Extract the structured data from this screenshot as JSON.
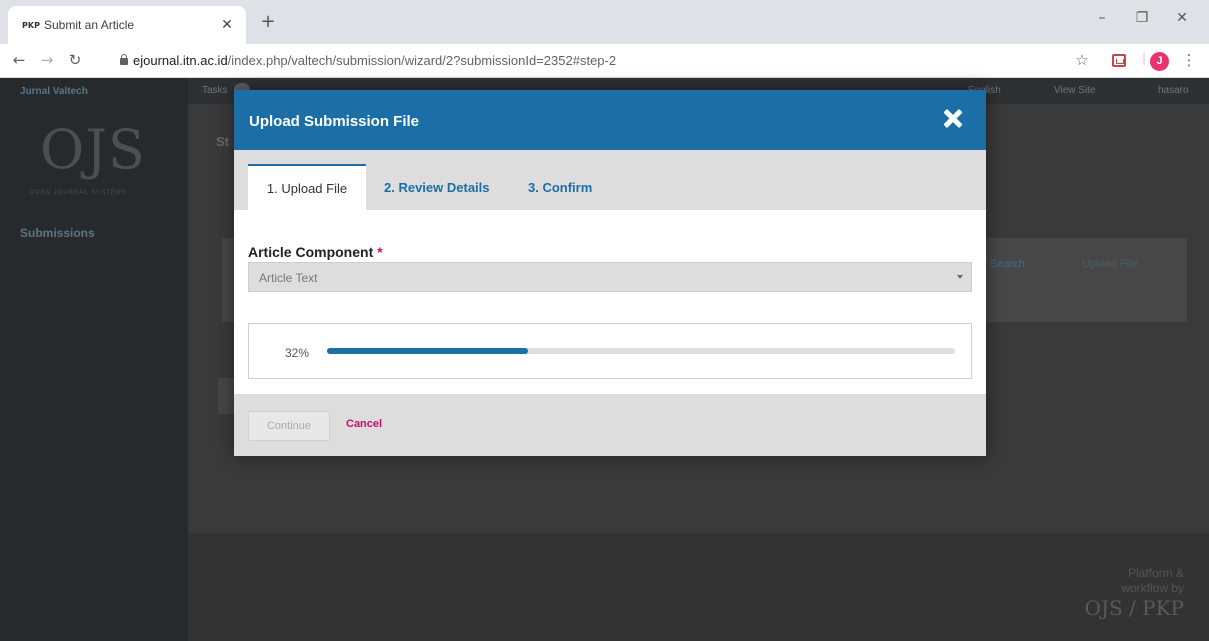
{
  "browser": {
    "tab_favicon_text": "PKP",
    "tab_title": "Submit an Article",
    "url_host": "ejournal.itn.ac.id",
    "url_path": "/index.php/valtech/submission/wizard/2?submissionId=2352#step-2",
    "profile_initial": "J",
    "profile_color": "#e8336e"
  },
  "ojs": {
    "journal_name": "Jurnal Valtech",
    "logo_text": "OJS",
    "logo_subtitle": "OPEN JOURNAL SYSTEMS",
    "nav": {
      "submissions": "Submissions"
    },
    "topbar": {
      "tasks": "Tasks",
      "language": "English",
      "view_site": "View Site",
      "user": "hasaro"
    },
    "main_heading_partial": "St",
    "panel": {
      "search": "Search",
      "upload_file": "Upload File"
    },
    "footer": {
      "platform_line1": "Platform &",
      "platform_line2": "workflow by",
      "pkp_logo": "OJS / PKP"
    }
  },
  "modal": {
    "title": "Upload Submission File",
    "tabs": [
      {
        "label": "1. Upload File",
        "active": true
      },
      {
        "label": "2. Review Details",
        "active": false
      },
      {
        "label": "3. Confirm",
        "active": false
      }
    ],
    "field": {
      "label": "Article Component",
      "required_marker": "*",
      "selected_value": "Article Text"
    },
    "upload_progress": {
      "percent": 32,
      "label": "32%"
    },
    "buttons": {
      "continue": "Continue",
      "cancel": "Cancel"
    },
    "accent_color": "#1b6fa6",
    "danger_color": "#d00a6c"
  }
}
